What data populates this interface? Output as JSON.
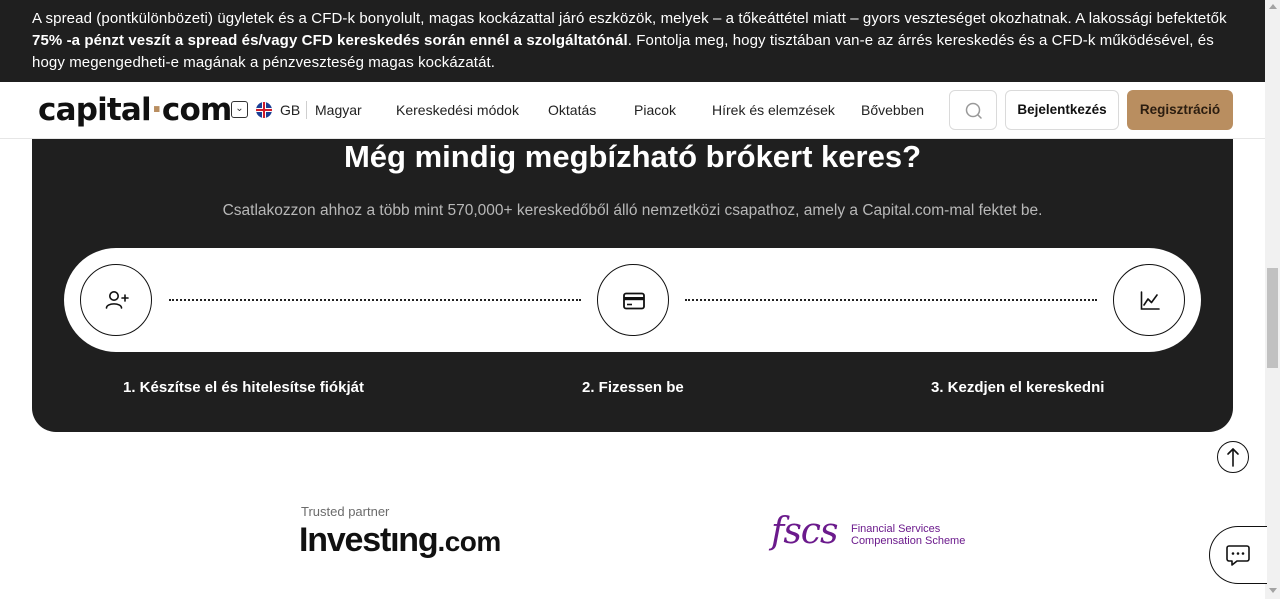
{
  "risk_banner": {
    "text_before": "A spread (pontkülönbözeti) ügyletek és a CFD-k bonyolult, magas kockázattal járó eszközök, melyek – a tőkeáttétel miatt – gyors veszteséget okozhatnak. A lakossági befektetők ",
    "bold": "75% -a pénzt veszít a spread és/vagy CFD kereskedés során ennél a szolgáltatónál",
    "text_after": ". Fontolja meg, hogy tisztában van-e az árrés kereskedés és a CFD-k működésével, és hogy megengedheti-e magának a pénzveszteség magas kockázatát."
  },
  "header": {
    "logo_left": "capital",
    "logo_dot": "·",
    "logo_right": "com",
    "region": "GB",
    "language": "Magyar",
    "nav": [
      "Kereskedési módok",
      "Oktatás",
      "Piacok",
      "Hírek és elemzések",
      "Bővebben"
    ],
    "login": "Bejelentkezés",
    "register": "Regisztráció"
  },
  "card": {
    "title": "Még mindig megbízható brókert keres?",
    "subtitle": "Csatlakozzon ahhoz a több mint 570,000+ kereskedőből álló nemzetközi csapathoz, amely a Capital.com-mal fektet be.",
    "steps": [
      {
        "label": "1. Készítse el és hitelesítse fiókját",
        "icon": "add-user-icon"
      },
      {
        "label": "2. Fizessen be",
        "icon": "credit-card-icon"
      },
      {
        "label": "3. Kezdjen el kereskedni",
        "icon": "chart-line-icon"
      }
    ]
  },
  "partners": {
    "trusted_label": "Trusted partner",
    "investing_main": "Investıng",
    "investing_suffix": ".com",
    "fscs_mark": "fscs",
    "fscs_line1": "Financial Services",
    "fscs_line2": "Compensation Scheme"
  },
  "colors": {
    "accent": "#b98e60",
    "dark": "#1f1f1f",
    "fscs_purple": "#6b1a8c"
  }
}
